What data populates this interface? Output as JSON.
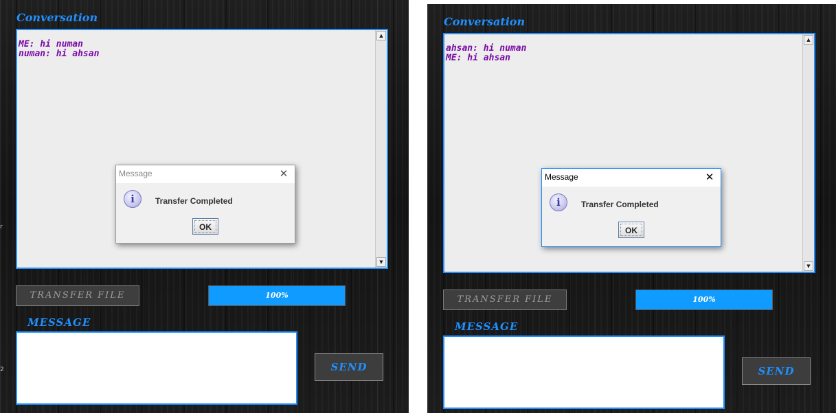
{
  "panels": [
    {
      "id": "left",
      "conversation_title": "Conversation",
      "conversation_text": "ME: hi numan\nnuman: hi ahsan",
      "transfer_button": "TRANSFER FILE",
      "progress": {
        "value": 100,
        "label": "100%"
      },
      "message_label": "MESSAGE",
      "message_value": "",
      "send_button": "SEND",
      "dialog": {
        "title": "Message",
        "text": "Transfer Completed",
        "ok": "OK",
        "focused": false
      },
      "edge_marks": [
        "r",
        "2"
      ]
    },
    {
      "id": "right",
      "conversation_title": "Conversation",
      "conversation_text": "ahsan: hi numan\nME: hi ahsan",
      "transfer_button": "TRANSFER FILE",
      "progress": {
        "value": 100,
        "label": "100%"
      },
      "message_label": "MESSAGE",
      "message_value": "",
      "send_button": "SEND",
      "dialog": {
        "title": "Message",
        "text": "Transfer Completed",
        "ok": "OK",
        "focused": true
      }
    }
  ],
  "colors": {
    "accent": "#1e90ff",
    "progress_fill": "#0f9bff",
    "conversation_text": "#7a0aa6",
    "background": "#1a1a1a"
  },
  "icons": [
    "info-icon",
    "close-icon",
    "scroll-up-arrow-icon",
    "scroll-down-arrow-icon"
  ]
}
